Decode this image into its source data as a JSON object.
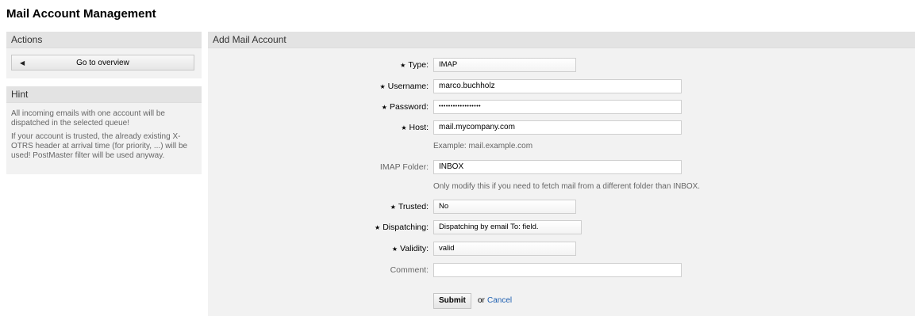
{
  "page": {
    "title": "Mail Account Management"
  },
  "sidebar": {
    "actions": {
      "title": "Actions",
      "overview_button": "Go to overview"
    },
    "hint": {
      "title": "Hint",
      "paragraphs": [
        "All incoming emails with one account will be dispatched in the selected queue!",
        "If your account is trusted, the already existing X-OTRS header at arrival time (for priority, ...) will be used! PostMaster filter will be used anyway."
      ]
    }
  },
  "form": {
    "title": "Add Mail Account",
    "type": {
      "label": "Type:",
      "value": "IMAP"
    },
    "username": {
      "label": "Username:",
      "value": "marco.buchholz"
    },
    "password": {
      "label": "Password:",
      "value": "••••••••••••••••••"
    },
    "host": {
      "label": "Host:",
      "value": "mail.mycompany.com",
      "help": "Example: mail.example.com"
    },
    "imap_folder": {
      "label": "IMAP Folder:",
      "value": "INBOX",
      "help": "Only modify this if you need to fetch mail from a different folder than INBOX."
    },
    "trusted": {
      "label": "Trusted:",
      "value": "No"
    },
    "dispatching": {
      "label": "Dispatching:",
      "value": "Dispatching by email To: field."
    },
    "validity": {
      "label": "Validity:",
      "value": "valid"
    },
    "comment": {
      "label": "Comment:",
      "value": ""
    },
    "submit_label": "Submit",
    "or_text": "or",
    "cancel_label": "Cancel",
    "required_mark": "★"
  }
}
